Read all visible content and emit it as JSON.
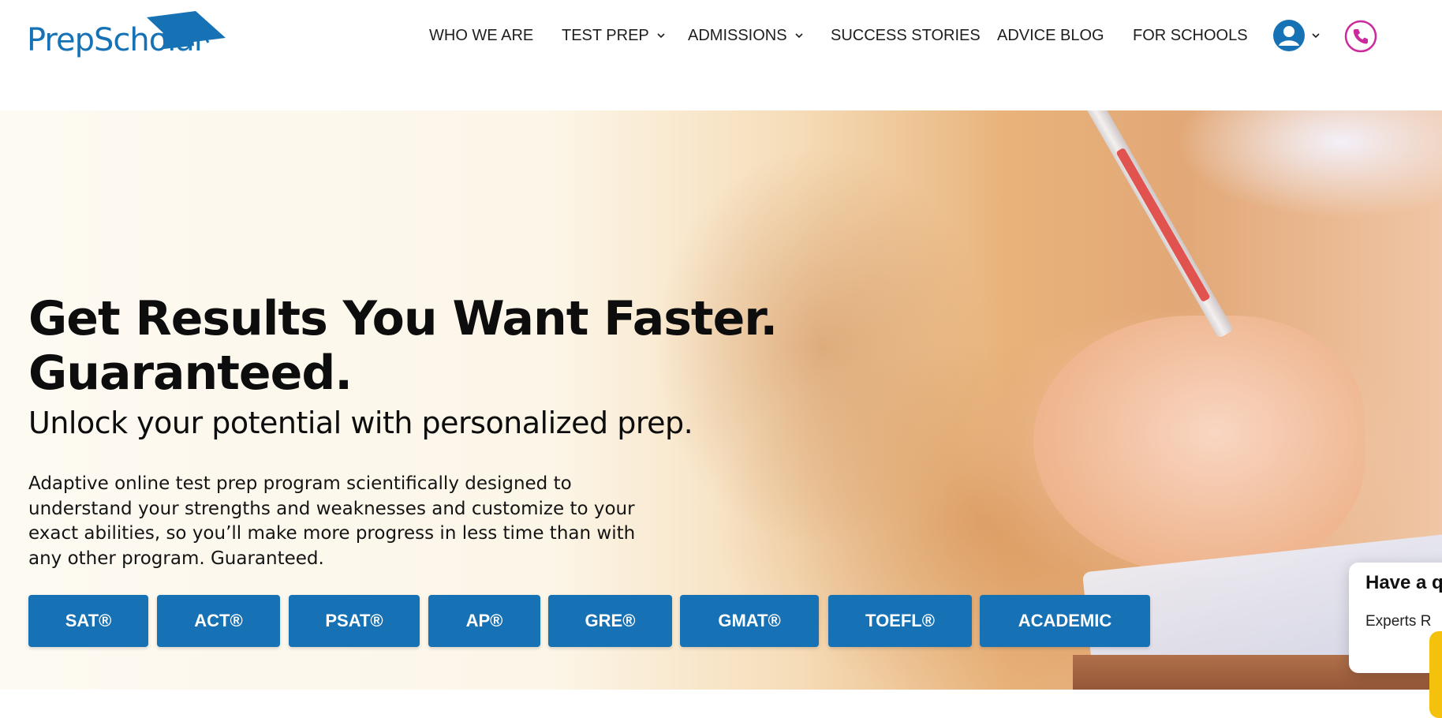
{
  "brand": {
    "name": "PrepScholar",
    "accent": "#1772b5"
  },
  "nav": {
    "items": [
      {
        "label": "WHO WE ARE",
        "dropdown": false
      },
      {
        "label": "TEST PREP",
        "dropdown": true
      },
      {
        "label": "ADMISSIONS",
        "dropdown": true
      },
      {
        "label": "SUCCESS STORIES",
        "dropdown": false
      },
      {
        "label": "ADVICE BLOG",
        "dropdown": false
      },
      {
        "label": "FOR SCHOOLS",
        "dropdown": false
      }
    ],
    "account_icon": "user-circle-icon",
    "phone_icon": "phone-icon",
    "phone_color": "#cc2a9c"
  },
  "hero": {
    "headline_line1": "Get Results You Want Faster.",
    "headline_line2": "Guaranteed.",
    "subheadline": "Unlock your potential with personalized prep.",
    "description": "Adaptive online test prep program scientifically designed to understand your strengths and weaknesses and customize to your exact abilities, so you’ll make more progress in less time than with any other program. Guaranteed.",
    "buttons": [
      {
        "label": "SAT®"
      },
      {
        "label": "ACT®"
      },
      {
        "label": "PSAT®"
      },
      {
        "label": "AP®"
      },
      {
        "label": "GRE®"
      },
      {
        "label": "GMAT®"
      },
      {
        "label": "TOEFL®"
      },
      {
        "label": "ACADEMIC"
      }
    ]
  },
  "chat": {
    "title": "Have a q",
    "subtitle": "Experts R",
    "accent": "#f4c20d"
  }
}
